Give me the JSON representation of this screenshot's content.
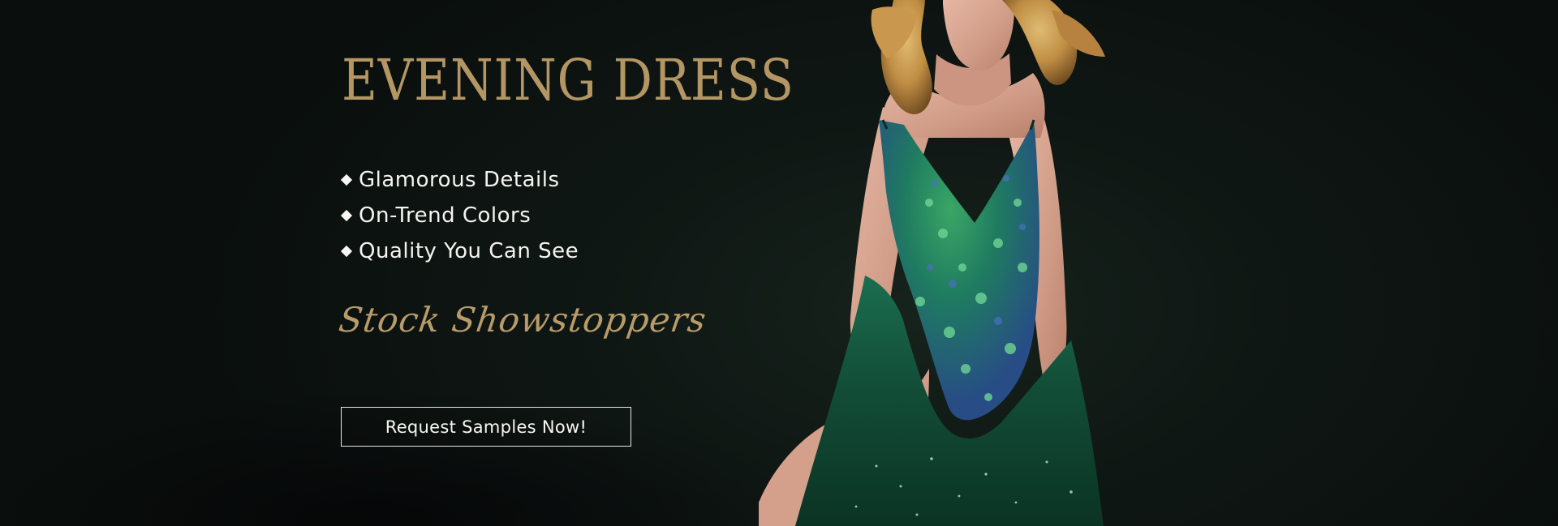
{
  "banner": {
    "headline": "EVENING DRESS",
    "features": [
      {
        "label": "Glamorous Details"
      },
      {
        "label": "On-Trend Colors"
      },
      {
        "label": "Quality You Can See"
      }
    ],
    "script_tagline": "Stock Showstoppers",
    "cta_label": "Request Samples Now!",
    "colors": {
      "background": "#0f1613",
      "headline_gold": "#b39663",
      "script_gold": "#b89b68",
      "text_white": "#f4f4f1",
      "dress_emerald": "#145c3f"
    },
    "icons": {
      "bullet": "diamond-bullet-icon"
    }
  }
}
